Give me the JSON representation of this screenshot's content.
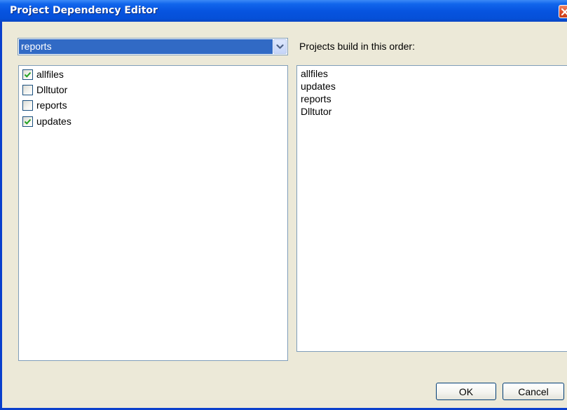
{
  "window": {
    "title": "Project Dependency Editor"
  },
  "project_select": {
    "selected": "reports"
  },
  "dependencies": {
    "items": [
      {
        "label": "allfiles",
        "checked": true
      },
      {
        "label": "Dlltutor",
        "checked": false
      },
      {
        "label": "reports",
        "checked": false
      },
      {
        "label": "updates",
        "checked": true
      }
    ]
  },
  "build_order": {
    "label": "Projects build in this order:",
    "items": [
      "allfiles",
      "updates",
      "reports",
      "Dlltutor"
    ]
  },
  "buttons": {
    "ok": "OK",
    "cancel": "Cancel"
  },
  "colors": {
    "titlebar": "#0754e0",
    "selection": "#316ac5",
    "check_mark": "#21a121",
    "close_button": "#e0502a"
  },
  "icons": {
    "close": "close-icon",
    "dropdown": "chevron-down-icon",
    "check": "checkmark-icon"
  }
}
